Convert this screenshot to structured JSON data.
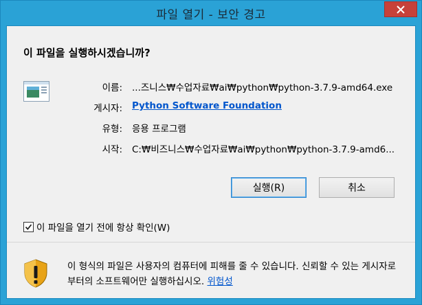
{
  "window": {
    "title": "파일 열기 - 보안 경고"
  },
  "question": "이 파일을 실행하시겠습니까?",
  "fields": {
    "name_label": "이름:",
    "name_value": "...즈니스₩수업자료₩ai₩python₩python-3.7.9-amd64.exe",
    "publisher_label": "게시자:",
    "publisher_value": "Python Software Foundation",
    "type_label": "유형:",
    "type_value": "응용 프로그램",
    "from_label": "시작:",
    "from_value": "C:₩비즈니스₩수업자료₩ai₩python₩python-3.7.9-amd6..."
  },
  "buttons": {
    "run": "실행(R)",
    "cancel": "취소"
  },
  "checkbox": {
    "label": "이 파일을 열기 전에 항상 확인(W)",
    "checked": true
  },
  "warning": {
    "text": "이 형식의 파일은 사용자의 컴퓨터에 피해를 줄 수 있습니다. 신뢰할 수 있는 게시자로부터의 소프트웨어만 실행하십시오.",
    "link": "위험성"
  },
  "icons": {
    "close": "close-icon",
    "app": "application-icon",
    "check": "checkmark-icon",
    "shield": "security-shield-icon"
  },
  "colors": {
    "title_bar": "#2aa2d6",
    "close_button": "#c7413a",
    "link": "#0055cc",
    "dialog_bg": "#f0f0f0"
  }
}
